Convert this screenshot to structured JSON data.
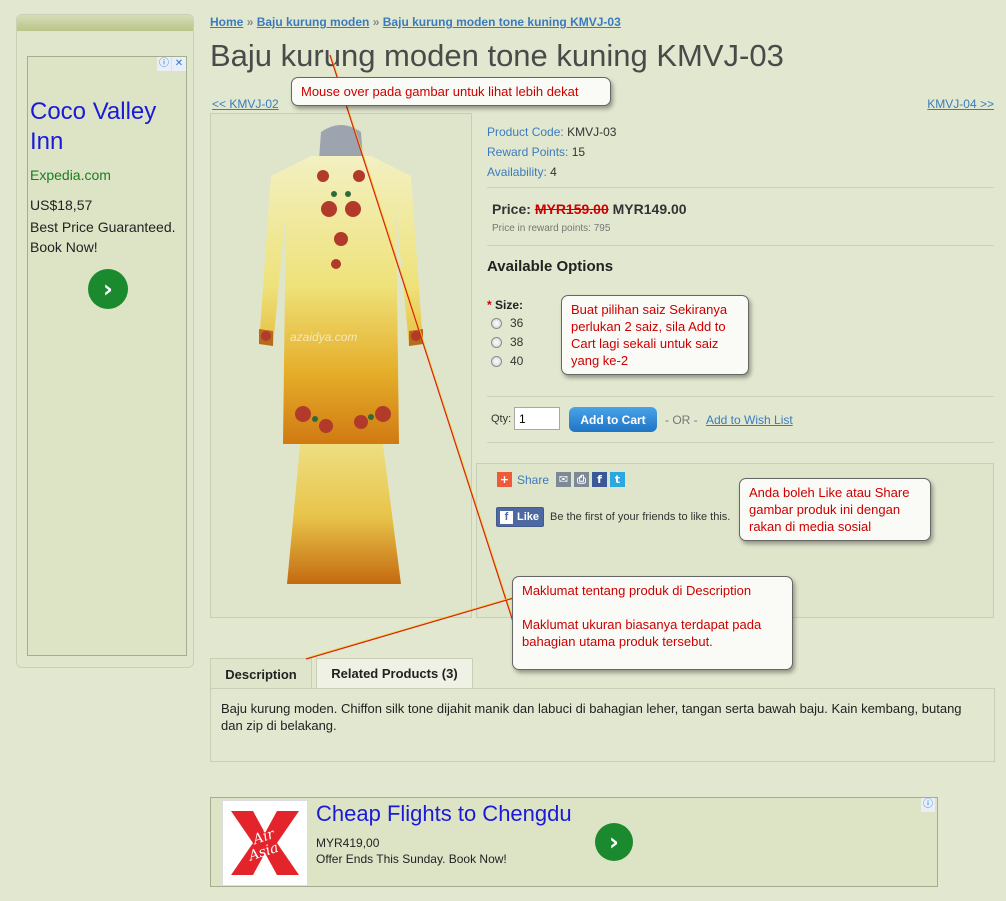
{
  "breadcrumb": {
    "home": "Home",
    "sep": "»",
    "category": "Baju kurung moden",
    "current": "Baju kurung moden tone kuning KMVJ-03"
  },
  "product": {
    "title": "Baju kurung moden tone kuning KMVJ-03",
    "prev": "<< KMVJ-02",
    "next": "KMVJ-04 >>",
    "code_label": "Product Code:",
    "code_value": "KMVJ-03",
    "points_label": "Reward Points:",
    "points_value": "15",
    "avail_label": "Availability:",
    "avail_value": "4",
    "price_label": "Price:",
    "price_old": "MYR159.00",
    "price_new": "MYR149.00",
    "price_points": "Price in reward points: 795",
    "watermark": "azaidya.com"
  },
  "options": {
    "title": "Available Options",
    "size_label": "Size:",
    "required": "*",
    "sizes": [
      "36",
      "38",
      "40"
    ]
  },
  "cart": {
    "qty_label": "Qty:",
    "qty_value": "1",
    "add_label": "Add to Cart",
    "or_text": "- OR -",
    "wish_label": "Add to Wish List"
  },
  "share": {
    "label": "Share",
    "like_label": "Like",
    "like_text": "Be the first of your friends to like this."
  },
  "tabs": {
    "description": "Description",
    "related": "Related Products (3)"
  },
  "description_text": "Baju kurung moden. Chiffon silk tone dijahit manik dan labuci di bahagian leher, tangan serta bawah baju. Kain kembang, butang dan zip di belakang.",
  "callouts": {
    "mouseover": "Mouse over pada gambar untuk lihat lebih dekat",
    "size": "Buat pilihan saiz Sekiranya perlukan 2 saiz, sila Add to Cart lagi sekali untuk saiz yang ke-2",
    "social": "Anda boleh Like atau Share gambar produk ini dengan rakan di media sosial",
    "desc_line1": "Maklumat tentang produk di Description",
    "desc_line2": "Maklumat ukuran biasanya terdapat pada bahagian utama produk tersebut."
  },
  "ad_left": {
    "title": "Coco Valley Inn",
    "domain": "Expedia.com",
    "price": "US$18,57",
    "desc": "Best Price Guaranteed. Book Now!",
    "info_icon": "ⓘ",
    "close_icon": "✕"
  },
  "ad_bottom": {
    "title": "Cheap Flights to Chengdu",
    "price": "MYR419,00",
    "desc": "Offer Ends This Sunday. Book Now!",
    "logo_text": "AirAsia",
    "info_icon": "ⓘ"
  },
  "colors": {
    "page_bg": "#e2e8cf",
    "link": "#3a7bbf",
    "callout_text": "#cc0000",
    "cart_button": "#1f74c4",
    "airasia_red": "#e3242b"
  }
}
